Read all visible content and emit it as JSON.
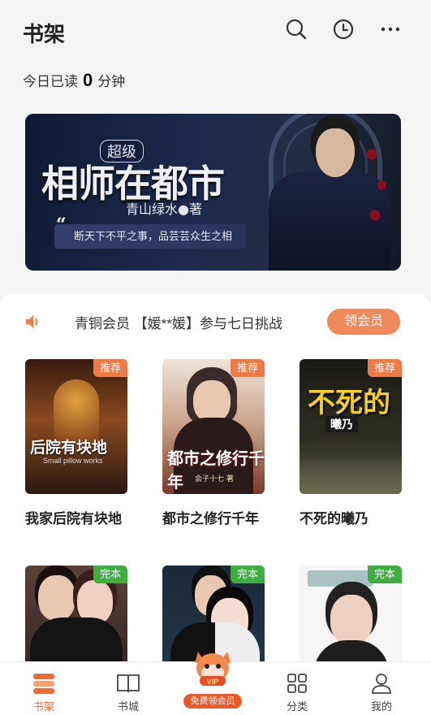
{
  "header": {
    "title": "书架",
    "icons": [
      "search-icon",
      "history-clock-icon",
      "more-dots-icon"
    ]
  },
  "reading": {
    "prefix": "今日已读",
    "minutes": "0",
    "unit": "分钟"
  },
  "banner": {
    "super_label": "超级",
    "title": "相师在都市",
    "author": "青山绿水",
    "author_suffix": "著",
    "quote_mark": "“",
    "slogan": "断天下不平之事，品芸芸众生之相"
  },
  "notice": {
    "message": "青铜会员 【媛**媛】参与七日挑战",
    "button": "领会员"
  },
  "books": [
    {
      "title": "我家后院有块地",
      "tag": "推荐",
      "tag_type": "rec",
      "cover_text": "后院有块地",
      "cover_sub": "Small pillow works",
      "colors": [
        "#2a1a12",
        "#8a4a1e",
        "#e0a040"
      ]
    },
    {
      "title": "都市之修行千年",
      "tag": "推荐",
      "tag_type": "rec",
      "cover_text": "都市之修行千年",
      "cover_sub": "会子十七 著",
      "colors": [
        "#e8d6c8",
        "#b07a62",
        "#5a2a22"
      ]
    },
    {
      "title": "不死的曦乃",
      "tag": "推荐",
      "tag_type": "rec",
      "cover_text": "不死的",
      "cover_sub": "曦乃",
      "colors": [
        "#1c1c16",
        "#3a3a2a",
        "#6a6a50"
      ]
    },
    {
      "title": "",
      "tag": "完本",
      "tag_type": "done",
      "cover_text": "",
      "cover_sub": "",
      "colors": [
        "#2a2020",
        "#6a4a40",
        "#c09080"
      ]
    },
    {
      "title": "",
      "tag": "完本",
      "tag_type": "done",
      "cover_text": "",
      "cover_sub": "",
      "colors": [
        "#1a2a3a",
        "#2a3a4a",
        "#c8b0a8"
      ]
    },
    {
      "title": "",
      "tag": "完本",
      "tag_type": "done",
      "cover_text": "",
      "cover_sub": "",
      "colors": [
        "#f4f4f4",
        "#e0e0e0",
        "#3a3a3a"
      ]
    }
  ],
  "tabs": [
    {
      "label": "书架",
      "icon": "bookshelf-icon",
      "active": true
    },
    {
      "label": "书城",
      "icon": "open-book-icon",
      "active": false
    },
    {
      "label": "免费领会员",
      "icon": "vip-mascot-icon",
      "active": false
    },
    {
      "label": "分类",
      "icon": "grid-icon",
      "active": false
    },
    {
      "label": "我的",
      "icon": "user-icon",
      "active": false
    }
  ],
  "vip_badge_text": "VIP",
  "colors": {
    "accent": "#f06a32",
    "notice_button": "#f08a5d",
    "tag_recommend": "#f07a43",
    "tag_finished": "#3eae42"
  }
}
